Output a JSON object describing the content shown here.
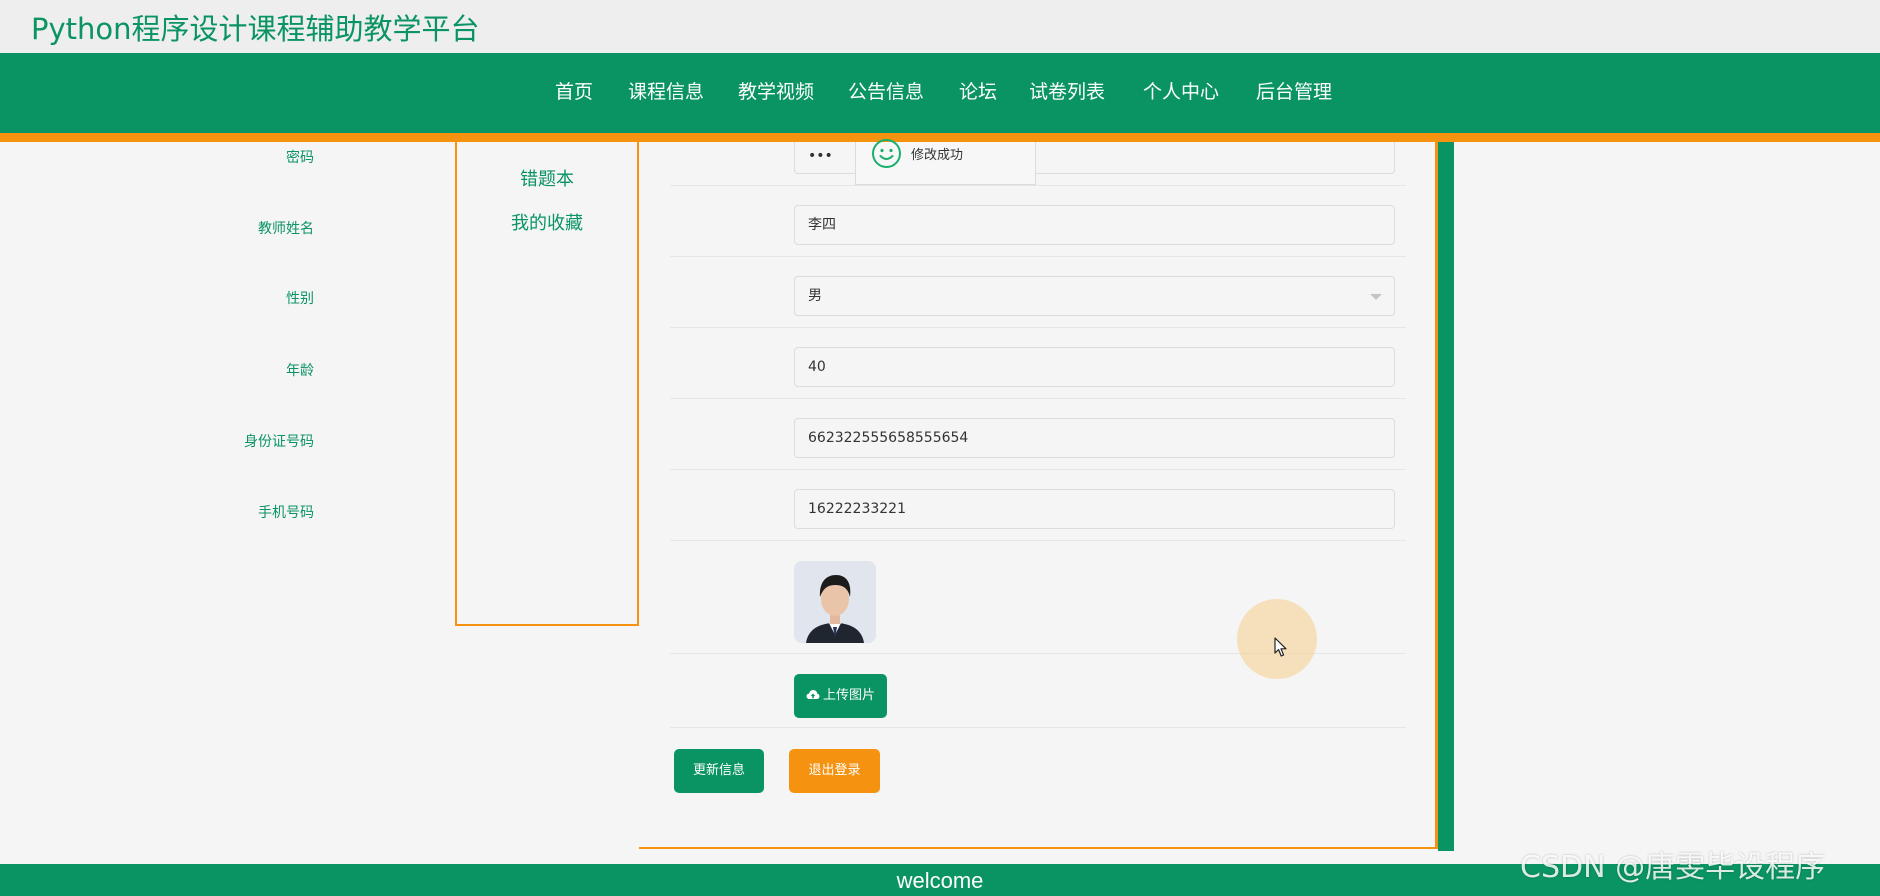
{
  "header": {
    "site_title": "Python程序设计课程辅助教学平台"
  },
  "nav": {
    "items": [
      "首页",
      "课程信息",
      "教学视频",
      "公告信息",
      "论坛",
      "试卷列表",
      "个人中心",
      "后台管理"
    ]
  },
  "sidebar": {
    "items": [
      "错题本",
      "我的收藏"
    ]
  },
  "form": {
    "password": {
      "label": "密码",
      "value": "•••"
    },
    "teacher_name": {
      "label": "教师姓名",
      "value": "李四"
    },
    "gender": {
      "label": "性别",
      "value": "男"
    },
    "age": {
      "label": "年龄",
      "value": "40"
    },
    "id_number": {
      "label": "身份证号码",
      "value": "662322555658555654"
    },
    "phone": {
      "label": "手机号码",
      "value": "16222233221"
    },
    "upload_label": "上传图片",
    "update_button": "更新信息",
    "logout_button": "退出登录"
  },
  "toast": {
    "message": "修改成功"
  },
  "footer": {
    "text": "welcome"
  },
  "watermark": "CSDN @唐雯毕设程序",
  "colors": {
    "primary": "#0a9463",
    "accent": "#f5920f",
    "background": "#f5f5f5"
  },
  "icons": {
    "toast": "smile-icon",
    "upload": "cloud-upload-icon",
    "select": "chevron-down-icon"
  }
}
